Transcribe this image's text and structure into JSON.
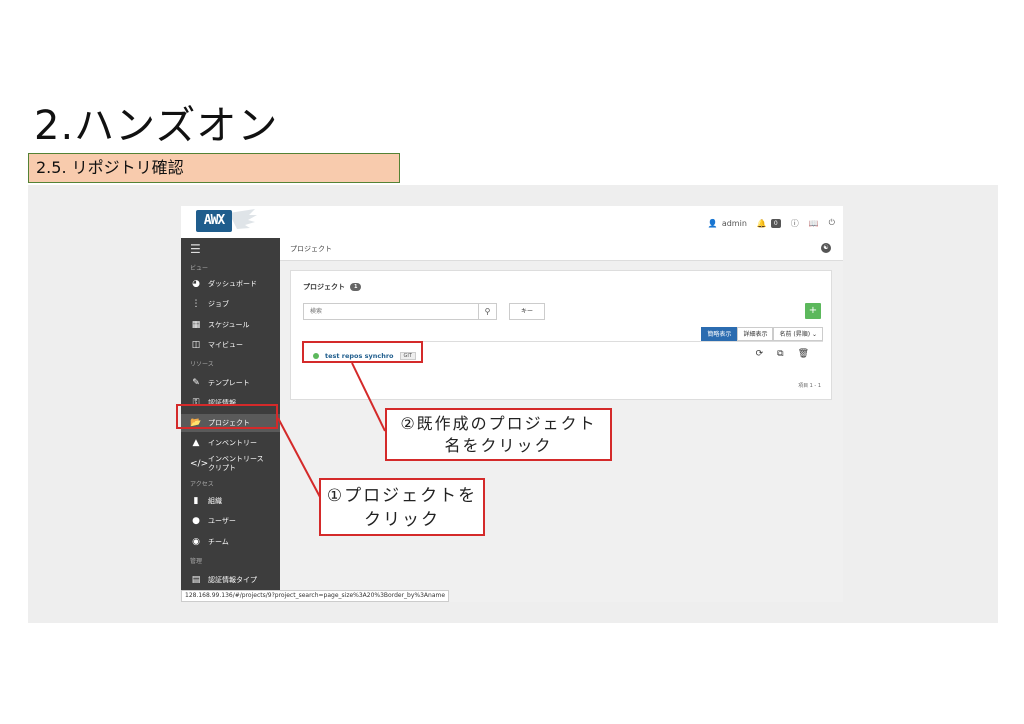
{
  "slide": {
    "title": "2.ハンズオン",
    "section": "2.5. リポジトリ確認"
  },
  "app": {
    "logo": "AWX",
    "header": {
      "user": "admin",
      "notification_count": "0"
    },
    "sidebar": {
      "sections": [
        {
          "label": "ビュー"
        },
        {
          "label": "リソース"
        },
        {
          "label": "アクセス"
        },
        {
          "label": "管理"
        }
      ],
      "items": [
        {
          "label": "ダッシュボード",
          "icon": "dashboard-icon"
        },
        {
          "label": "ジョブ",
          "icon": "spinner-icon"
        },
        {
          "label": "スケジュール",
          "icon": "calendar-icon"
        },
        {
          "label": "マイビュー",
          "icon": "columns-icon"
        },
        {
          "label": "テンプレート",
          "icon": "edit-icon"
        },
        {
          "label": "認証情報",
          "icon": "key-icon"
        },
        {
          "label": "プロジェクト",
          "icon": "folder-open-icon"
        },
        {
          "label": "インベントリー",
          "icon": "sitemap-icon"
        },
        {
          "label": "インベントリースクリプト",
          "icon": "code-icon"
        },
        {
          "label": "組織",
          "icon": "building-icon"
        },
        {
          "label": "ユーザー",
          "icon": "user-icon"
        },
        {
          "label": "チーム",
          "icon": "users-icon"
        },
        {
          "label": "認証情報タイプ",
          "icon": "list-alt-icon"
        }
      ]
    },
    "breadcrumb": "プロジェクト",
    "card": {
      "title": "プロジェクト",
      "count": "1",
      "search_placeholder": "検索",
      "key_button": "キー",
      "add_button": "+",
      "view_buttons": [
        "簡略表示",
        "詳細表示"
      ],
      "sort_select": "名前 (昇順)",
      "projects": [
        {
          "name": "test repos synchro",
          "scm_type": "GIT",
          "status": "successful"
        }
      ],
      "item_count": "項目 1 - 1"
    },
    "status_url": "128.168.99.136/#/projects/9?project_search=page_size%3A20%3Border_by%3Aname"
  },
  "callouts": {
    "step1": "①プロジェクトを\nクリック",
    "step2": "②既作成のプロジェクト\n名をクリック"
  },
  "colors": {
    "highlight": "#d42a2a",
    "sidebar_bg": "#3d3d3d",
    "section_bg": "#f8cbad",
    "accent_blue": "#1f5d8d",
    "add_green": "#5cb85c"
  }
}
